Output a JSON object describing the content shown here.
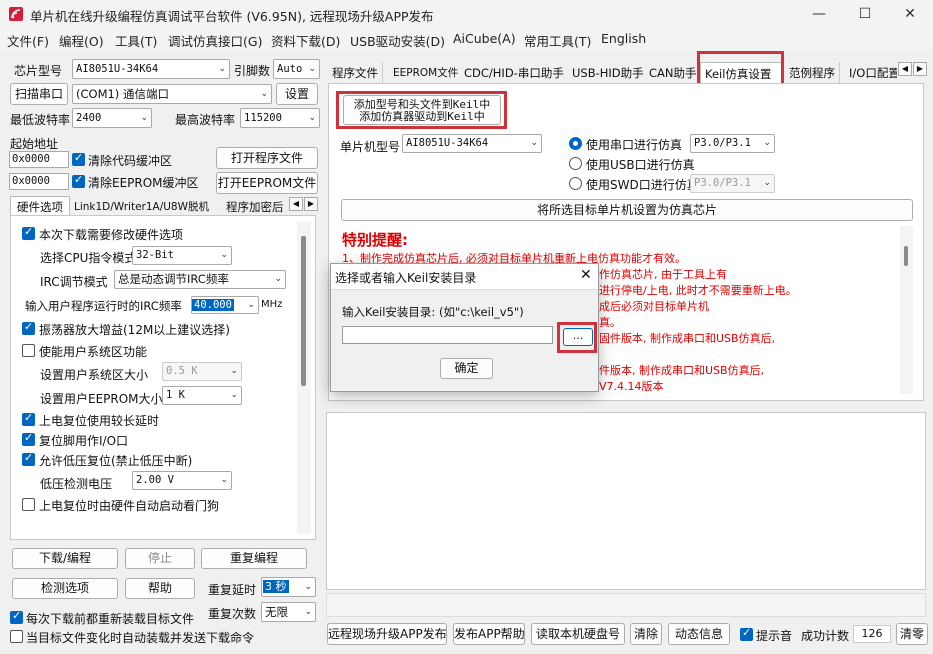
{
  "window": {
    "title": "单片机在线升级编程仿真调试平台软件 (V6.95N), 远程现场升级APP发布",
    "controls": [
      "—",
      "☐",
      "✕"
    ]
  },
  "menu": [
    "文件(F)",
    "编程(O)",
    "工具(T)",
    "调试仿真接口(G)",
    "资料下载(D)",
    "USB驱动安装(D)",
    "AiCube(A)",
    "常用工具(T)",
    "English"
  ],
  "left": {
    "chip_type_label": "芯片型号",
    "chip_type_value": "AI8051U-34K64",
    "pins_label": "引脚数",
    "pins_value": "Auto",
    "scan_button": "扫描串口",
    "port_value": "(COM1) 通信端口",
    "settings_button": "设置",
    "min_baud_label": "最低波特率",
    "min_baud_value": "2400",
    "max_baud_label": "最高波特率",
    "max_baud_value": "115200",
    "start_addr_label": "起始地址",
    "code_addr": "0x0000",
    "clear_code_label": "清除代码缓冲区",
    "open_program_button": "打开程序文件",
    "eeprom_addr": "0x0000",
    "clear_eeprom_label": "清除EEPROM缓冲区",
    "open_eeprom_button": "打开EEPROM文件",
    "hw_tabs": [
      "硬件选项",
      "Link1D/Writer1A/U8W脱机",
      "程序加密后"
    ],
    "hw_options": {
      "modify_hw": "本次下载需要修改硬件选项",
      "cpu_mode_label": "选择CPU指令模式",
      "cpu_mode_value": "32-Bit",
      "irc_mode_label": "IRC调节模式",
      "irc_mode_value": "总是动态调节IRC频率",
      "irc_freq_label": "输入用户程序运行时的IRC频率",
      "irc_freq_value": "40.000",
      "irc_freq_unit": "MHz",
      "osc_gain": "振荡器放大增益(12M以上建议选择)",
      "user_sys_area": "使能用户系统区功能",
      "sys_area_size_label": "设置用户系统区大小",
      "sys_area_size_value": "0.5 K",
      "eeprom_size_label": "设置用户EEPROM大小",
      "eeprom_size_value": "1  K",
      "long_delay": "上电复位使用较长延时",
      "reset_io": "复位脚用作I/O口",
      "lvr_reset": "允许低压复位(禁止低压中断)",
      "lvd_label": "低压检测电压",
      "lvd_value": "2.00 V",
      "watchdog": "上电复位时由硬件自动启动看门狗"
    },
    "download_button": "下载/编程",
    "stop_button": "停止",
    "reprogram_button": "重复编程",
    "check_button": "检测选项",
    "help_button": "帮助",
    "repeat_delay_label": "重复延时",
    "repeat_delay_value": "3 秒",
    "repeat_count_label": "重复次数",
    "repeat_count_value": "无限",
    "reload_each": "每次下载前都重新装载目标文件",
    "auto_load": "当目标文件变化时自动装载并发送下载命令"
  },
  "right": {
    "tabs": [
      "程序文件",
      "EEPROM文件",
      "CDC/HID-串口助手",
      "USB-HID助手",
      "CAN助手",
      "Keil仿真设置",
      "范例程序",
      "I/O口配置"
    ],
    "add_keil_line1": "添加型号和头文件到Keil中",
    "add_keil_line2": "添加仿真器驱动到Keil中",
    "mcu_label": "单片机型号",
    "mcu_value": "AI8051U-34K64",
    "uart_sim": "使用串口进行仿真",
    "uart_pins": "P3.0/P3.1",
    "usb_sim": "使用USB口进行仿真",
    "swd_sim": "使用SWD口进行仿真",
    "swd_pins": "P3.0/P3.1",
    "set_chip_button": "将所选目标单片机设置为仿真芯片",
    "notice_title": "特别提醒:",
    "notice_line1": "1、制作完成仿真芯片后, 必须对目标单片机重新上电仿真功能才有效。",
    "notice_fragments": [
      "作仿真芯片, 由于工具上有",
      "进行停电/上电, 此时才不需要重新上电。",
      "成后必须对目标单片机",
      "真。",
      "固件版本, 制作成串口和USB仿真后,",
      "件版本, 制作成串口和USB仿真后,",
      "V7.4.14版本"
    ],
    "bottom_buttons": [
      "远程现场升级APP发布",
      "发布APP帮助",
      "读取本机硬盘号",
      "清除",
      "动态信息"
    ],
    "beep_label": "提示音",
    "success_label": "成功计数",
    "success_value": "126",
    "clear_count_button": "清零"
  },
  "dialog": {
    "title": "选择或者输入Keil安装目录",
    "prompt": "输入Keil安装目录: (如\"c:\\keil_v5\")",
    "path_value": "",
    "browse_button": "...",
    "ok_button": "确定"
  },
  "colors": {
    "accent": "#0067c0",
    "highlight_red": "#d0313a",
    "notice_red": "#e00000"
  }
}
